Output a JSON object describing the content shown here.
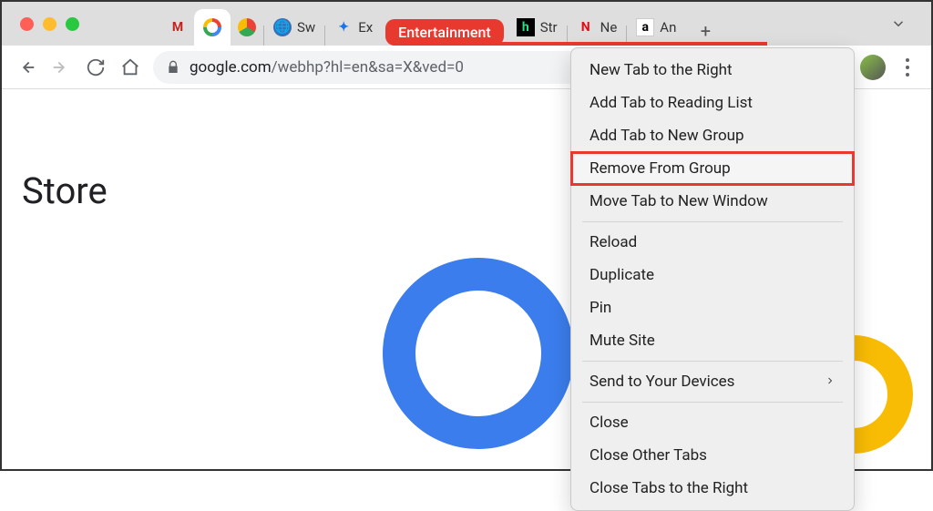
{
  "url": {
    "host": "google.com",
    "path": "/webhp?hl=en&sa=X&ved=0"
  },
  "tabs": {
    "gmail_label": "",
    "google_label": "",
    "chrome_label": "",
    "safari_label": "Sw",
    "extensions_label": "Ex",
    "hulu_label": "Str",
    "netflix_label": "Ne",
    "amazon_label": "An"
  },
  "group": {
    "label": "Entertainment",
    "color": "#e8392f"
  },
  "page": {
    "store_text": "Store"
  },
  "context_menu": {
    "new_tab_right": "New Tab to the Right",
    "add_reading_list": "Add Tab to Reading List",
    "add_new_group": "Add Tab to New Group",
    "remove_from_group": "Remove From Group",
    "move_new_window": "Move Tab to New Window",
    "reload": "Reload",
    "duplicate": "Duplicate",
    "pin": "Pin",
    "mute_site": "Mute Site",
    "send_devices": "Send to Your Devices",
    "close": "Close",
    "close_other": "Close Other Tabs",
    "close_right": "Close Tabs to the Right"
  }
}
